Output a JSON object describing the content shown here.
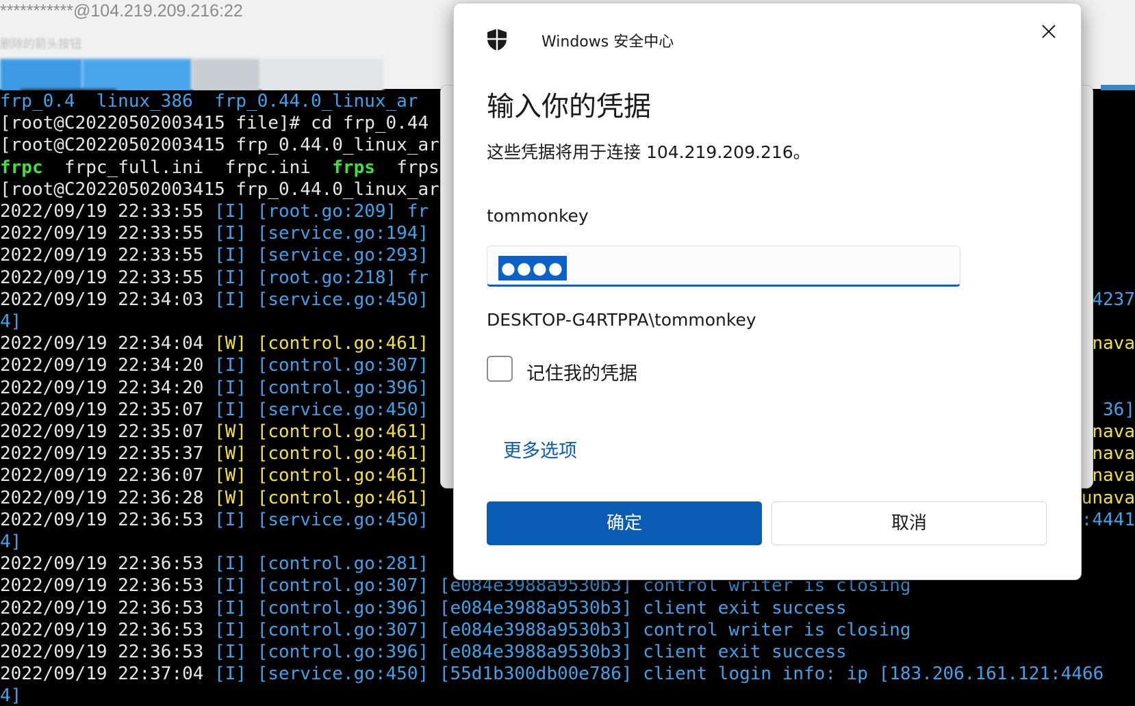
{
  "rdp": {
    "title": "***********@104.219.209.216:22",
    "subtitle": "删除的箭头按钮"
  },
  "terminal": {
    "lines": [
      {
        "segs": [
          {
            "t": "frp_0.4  linux_386  ",
            "c": "c-b"
          },
          {
            "t": "frp_0.44.0_linux_ar",
            "c": "c-b"
          }
        ]
      },
      {
        "segs": [
          {
            "t": "[root@C20220502003415 file]# cd frp_0.44",
            "c": "c-w"
          }
        ]
      },
      {
        "segs": [
          {
            "t": "[root@C20220502003415 frp_0.44.0_linux_ar",
            "c": "c-w"
          }
        ]
      },
      {
        "segs": [
          {
            "t": "frpc",
            "c": "c-g"
          },
          {
            "t": "  frpc_full.ini  frpc.ini  ",
            "c": "c-w"
          },
          {
            "t": "frps",
            "c": "c-g"
          },
          {
            "t": "  frps",
            "c": "c-w"
          }
        ]
      },
      {
        "segs": [
          {
            "t": "[root@C20220502003415 frp_0.44.0_linux_ar",
            "c": "c-w"
          }
        ]
      },
      {
        "segs": [
          {
            "t": "2022/09/19 22:33:55 ",
            "c": "c-w"
          },
          {
            "t": "[I] [root.go:209] fr",
            "c": "c-b"
          }
        ]
      },
      {
        "segs": [
          {
            "t": "2022/09/19 22:33:55 ",
            "c": "c-w"
          },
          {
            "t": "[I] [service.go:194]",
            "c": "c-b"
          }
        ]
      },
      {
        "segs": [
          {
            "t": "2022/09/19 22:33:55 ",
            "c": "c-w"
          },
          {
            "t": "[I] [service.go:293]",
            "c": "c-b"
          }
        ]
      },
      {
        "segs": [
          {
            "t": "2022/09/19 22:33:55 ",
            "c": "c-w"
          },
          {
            "t": "[I] [root.go:218] fr",
            "c": "c-b"
          }
        ]
      },
      {
        "segs": [
          {
            "t": "2022/09/19 22:34:03 ",
            "c": "c-w"
          },
          {
            "t": "[I] [service.go:450]",
            "c": "c-b"
          }
        ]
      },
      {
        "segs": [
          {
            "t": "4]",
            "c": "c-b"
          }
        ]
      },
      {
        "segs": [
          {
            "t": "2022/09/19 22:34:04 ",
            "c": "c-w"
          },
          {
            "t": "[W] [control.go:461]",
            "c": "c-y"
          }
        ]
      },
      {
        "segs": [
          {
            "t": "2022/09/19 22:34:20 ",
            "c": "c-w"
          },
          {
            "t": "[I] [control.go:307]",
            "c": "c-b"
          }
        ]
      },
      {
        "segs": [
          {
            "t": "2022/09/19 22:34:20 ",
            "c": "c-w"
          },
          {
            "t": "[I] [control.go:396]",
            "c": "c-b"
          }
        ]
      },
      {
        "segs": [
          {
            "t": "2022/09/19 22:35:07 ",
            "c": "c-w"
          },
          {
            "t": "[I] [service.go:450]",
            "c": "c-b"
          }
        ]
      },
      {
        "segs": [
          {
            "t": "2022/09/19 22:35:07 ",
            "c": "c-w"
          },
          {
            "t": "[W] [control.go:461]",
            "c": "c-y"
          }
        ]
      },
      {
        "segs": [
          {
            "t": "2022/09/19 22:35:37 ",
            "c": "c-w"
          },
          {
            "t": "[W] [control.go:461]",
            "c": "c-y"
          }
        ]
      },
      {
        "segs": [
          {
            "t": "2022/09/19 22:36:07 ",
            "c": "c-w"
          },
          {
            "t": "[W] [control.go:461]",
            "c": "c-y"
          }
        ]
      },
      {
        "segs": [
          {
            "t": "2022/09/19 22:36:28 ",
            "c": "c-w"
          },
          {
            "t": "[W] [control.go:461]",
            "c": "c-y"
          }
        ]
      },
      {
        "segs": [
          {
            "t": "2022/09/19 22:36:53 ",
            "c": "c-w"
          },
          {
            "t": "[I] [service.go:450]",
            "c": "c-b"
          }
        ]
      },
      {
        "segs": [
          {
            "t": "4]",
            "c": "c-b"
          }
        ]
      },
      {
        "segs": [
          {
            "t": "2022/09/19 22:36:53 ",
            "c": "c-w"
          },
          {
            "t": "[I] [control.go:281]",
            "c": "c-b"
          }
        ]
      },
      {
        "segs": [
          {
            "t": "2022/09/19 22:36:53 ",
            "c": "c-w"
          },
          {
            "t": "[I] [control.go:307] [e084e3988a9530b3] control writer is closing",
            "c": "c-b"
          }
        ]
      },
      {
        "segs": [
          {
            "t": "2022/09/19 22:36:53 ",
            "c": "c-w"
          },
          {
            "t": "[I] [control.go:396] [e084e3988a9530b3] client exit success",
            "c": "c-b"
          }
        ]
      },
      {
        "segs": [
          {
            "t": "2022/09/19 22:36:53 ",
            "c": "c-w"
          },
          {
            "t": "[I] [control.go:307] [e084e3988a9530b3] control writer is closing",
            "c": "c-b"
          }
        ]
      },
      {
        "segs": [
          {
            "t": "2022/09/19 22:36:53 ",
            "c": "c-w"
          },
          {
            "t": "[I] [control.go:396] [e084e3988a9530b3] client exit success",
            "c": "c-b"
          }
        ]
      },
      {
        "segs": [
          {
            "t": "2022/09/19 22:37:04 ",
            "c": "c-w"
          },
          {
            "t": "[I] [service.go:450] [55d1b300db00e786] client login info: ip [183.206.161.121:4466",
            "c": "c-b"
          }
        ]
      },
      {
        "segs": [
          {
            "t": "4]",
            "c": "c-b"
          }
        ]
      }
    ],
    "right_fragments": [
      {
        "row": 9,
        "t": "4237",
        "c": "c-b"
      },
      {
        "row": 11,
        "t": "unava",
        "c": "c-y"
      },
      {
        "row": 14,
        "t": "36]",
        "c": "c-b"
      },
      {
        "row": 15,
        "t": "unava",
        "c": "c-y"
      },
      {
        "row": 16,
        "t": "unava",
        "c": "c-y"
      },
      {
        "row": 17,
        "t": "unava",
        "c": "c-y"
      },
      {
        "row": 18,
        "t": "unava",
        "c": "c-y"
      },
      {
        "row": 19,
        "t": ":4441",
        "c": "c-b"
      }
    ]
  },
  "dialog": {
    "app_title": "Windows 安全中心",
    "heading": "输入你的凭据",
    "description": "这些凭据将用于连接 104.219.209.216。",
    "username": "tommonkey",
    "password_mask": "●●●●",
    "domain_user": "DESKTOP-G4RTPPA\\tommonkey",
    "remember_label": "记住我的凭据",
    "remember_checked": false,
    "more_options": "更多选项",
    "ok_label": "确定",
    "cancel_label": "取消",
    "accent_color": "#0b5cb5"
  }
}
